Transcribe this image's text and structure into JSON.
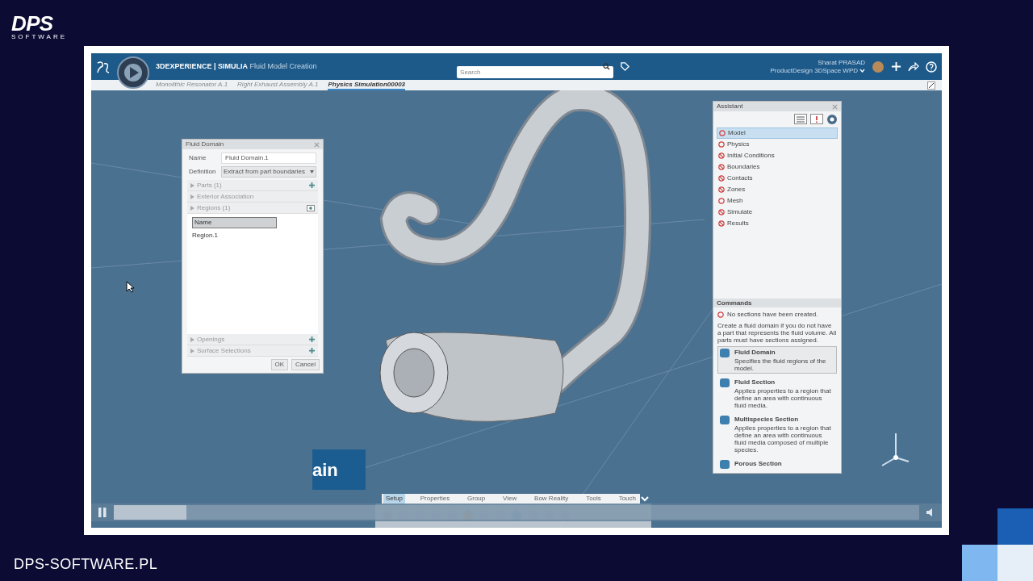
{
  "brand": {
    "logo": "DPS",
    "logo_sub": "SOFTWARE",
    "footer": "DPS-SOFTWARE.PL"
  },
  "app": {
    "title_bold": "3DEXPERIENCE | SIMULIA",
    "title_rest": "Fluid Model Creation",
    "search": {
      "placeholder": "Search"
    },
    "user": "Sharat PRASAD",
    "space": "ProductDesign  3DSpace WPD"
  },
  "tabs": [
    {
      "label": "Monolithic Resonator A.1",
      "selected": false
    },
    {
      "label": "Right Exhaust Assembly A.1",
      "selected": false
    },
    {
      "label": "Physics Simulation00003",
      "selected": true
    }
  ],
  "dialog": {
    "title": "Fluid Domain",
    "name_label": "Name",
    "name_value": "Fluid Domain.1",
    "definition_label": "Definition",
    "definition_value": "Extract from part boundaries",
    "sections": [
      {
        "label": "Parts (1)",
        "kind": "add"
      },
      {
        "label": "Exterior Association",
        "kind": "plain"
      },
      {
        "label": "Regions (1)",
        "kind": "list",
        "column": "Name",
        "rows": [
          "Region.1"
        ]
      },
      {
        "label": "Openings",
        "kind": "add"
      },
      {
        "label": "Surface Selections",
        "kind": "add"
      }
    ],
    "buttons": [
      "OK",
      "Cancel"
    ]
  },
  "assistant": {
    "title": "Assistant",
    "steps": [
      {
        "label": "Model",
        "kind": "pending",
        "selected": true
      },
      {
        "label": "Physics",
        "kind": "pending",
        "selected": false
      },
      {
        "label": "Initial Conditions",
        "kind": "blocked",
        "selected": false
      },
      {
        "label": "Boundaries",
        "kind": "blocked",
        "selected": false
      },
      {
        "label": "Contacts",
        "kind": "blocked",
        "selected": false
      },
      {
        "label": "Zones",
        "kind": "blocked",
        "selected": false
      },
      {
        "label": "Mesh",
        "kind": "pending",
        "selected": false
      },
      {
        "label": "Simulate",
        "kind": "blocked",
        "selected": false
      },
      {
        "label": "Results",
        "kind": "blocked",
        "selected": false
      }
    ],
    "commands_title": "Commands",
    "warning": "No sections have been created.",
    "hint": "Create a fluid domain if you do not have a part that represents the fluid volume. All parts must have sections assigned.",
    "commands": [
      {
        "title": "Fluid Domain",
        "description": "Specifies the fluid regions of the model.",
        "selected": true
      },
      {
        "title": "Fluid Section",
        "description": "Applies properties to a region that define an area with continuous fluid media.",
        "selected": false
      },
      {
        "title": "Multispecies Section",
        "description": "Applies properties to a region that define an area with continuous fluid media composed of multiple species.",
        "selected": false
      },
      {
        "title": "Porous Section",
        "selected": false
      }
    ]
  },
  "caption": "ain",
  "action_bar": {
    "tabs": [
      {
        "label": "Setup",
        "selected": true
      },
      {
        "label": "Properties",
        "selected": false
      },
      {
        "label": "Group",
        "selected": false
      },
      {
        "label": "View",
        "selected": false
      },
      {
        "label": "Bow Reality",
        "selected": false
      },
      {
        "label": "Tools",
        "selected": false
      },
      {
        "label": "Touch",
        "selected": false
      }
    ]
  },
  "player": {
    "level": 0.09
  }
}
